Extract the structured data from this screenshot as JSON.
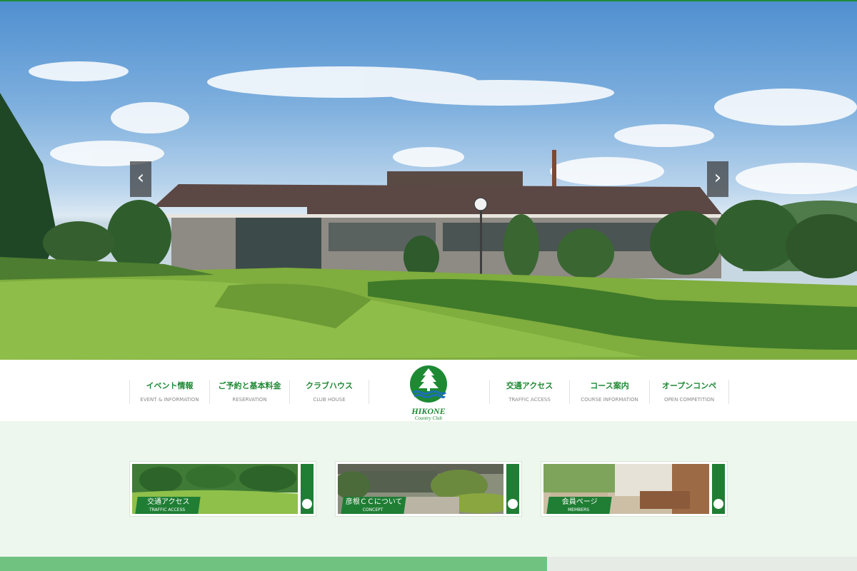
{
  "hero": {
    "prev_icon": "chevron-left-icon",
    "next_icon": "chevron-right-icon",
    "prev_glyph": "‹",
    "next_glyph": "›"
  },
  "nav": {
    "left": [
      {
        "jp": "イベント情報",
        "en": "EVENT & INFORMATION"
      },
      {
        "jp": "ご予約と基本料金",
        "en": "RESERVATION"
      },
      {
        "jp": "クラブハウス",
        "en": "CLUB HOUSE"
      }
    ],
    "right": [
      {
        "jp": "交通アクセス",
        "en": "TRAFFIC ACCESS"
      },
      {
        "jp": "コース案内",
        "en": "COURSE INFORMATION"
      },
      {
        "jp": "オープンコンペ",
        "en": "OPEN COMPETITION"
      }
    ]
  },
  "logo": {
    "name": "HIKONE",
    "sub": "Country Club"
  },
  "banners": [
    {
      "jp": "交通アクセス",
      "en": "TRAFFIC ACCESS"
    },
    {
      "jp": "彦根ＣＣについて",
      "en": "CONCEPT"
    },
    {
      "jp": "会員ページ",
      "en": "MEMBERS"
    }
  ],
  "colors": {
    "brand_green": "#1d8a33",
    "page_bg": "#eef7ee",
    "strip_green": "#6fc27f"
  }
}
